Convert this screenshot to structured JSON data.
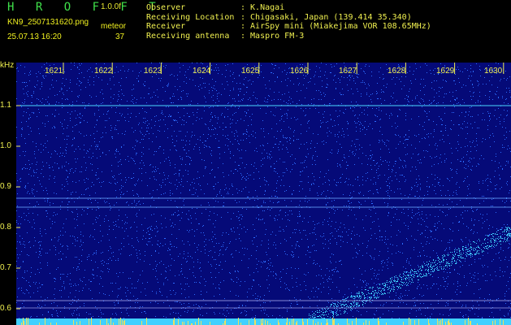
{
  "app": {
    "logo": "H R O F F T",
    "version": "1.0.0f",
    "filename": "KN9_2507131620.png",
    "meteor_label": "meteor",
    "datetime": "25.07.13 16:20",
    "meteor_count": "37"
  },
  "info": [
    {
      "label": "Observer",
      "value": ": K.Nagai"
    },
    {
      "label": "Receiving Location",
      "value": ": Chigasaki, Japan (139.414 35.340)"
    },
    {
      "label": "Receiver",
      "value": ": AirSpy mini (Miakejima VOR 108.65MHz)"
    },
    {
      "label": "Receiving antenna",
      "value": ": Maspro FM-3"
    }
  ],
  "spectrogram": {
    "unit": "kHz",
    "y_ticks": [
      "1.1",
      "1.0",
      "0.9",
      "0.8",
      "0.7",
      "0.6"
    ],
    "x_ticks": [
      "1621",
      "1622",
      "1623",
      "1624",
      "1625",
      "1626",
      "1627",
      "1628",
      "1629",
      "1630"
    ],
    "colors": {
      "background": "#050a78",
      "noise": "#2d6cff",
      "signal": "#40d0ff",
      "tick": "#f0f050"
    }
  }
}
